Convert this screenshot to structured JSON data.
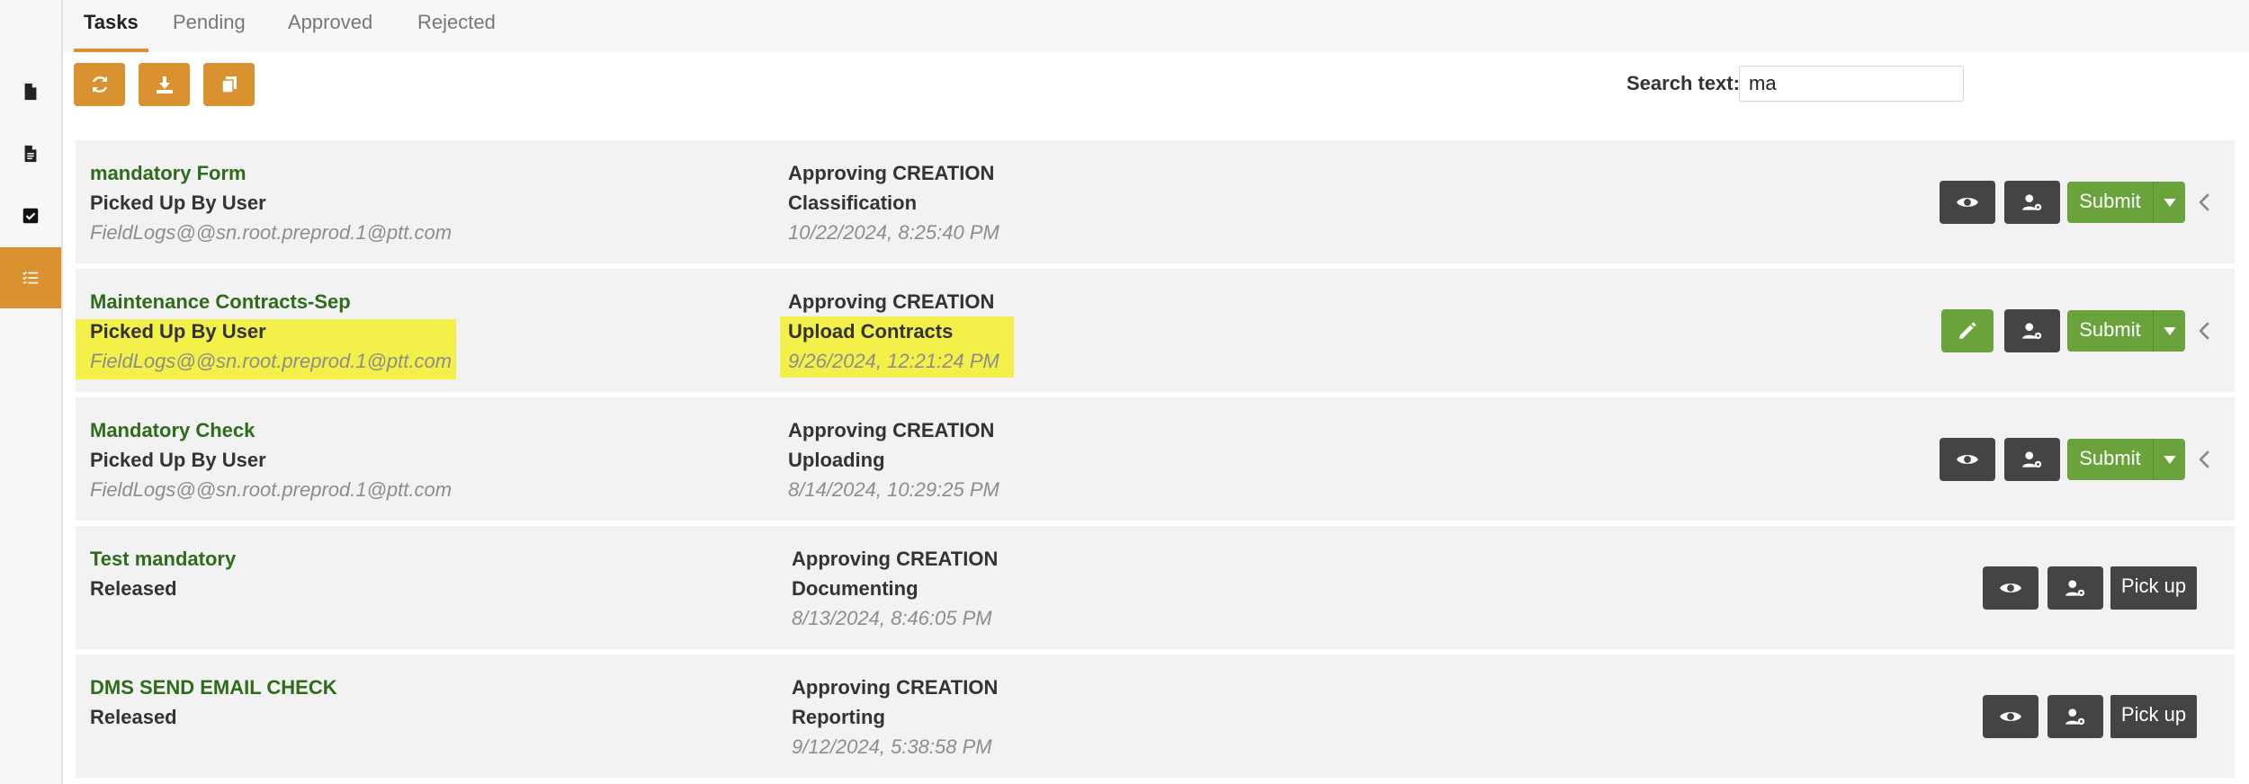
{
  "tabs": [
    "Tasks",
    "Pending",
    "Approved",
    "Rejected"
  ],
  "rail": {
    "items": [
      "document-icon",
      "document-lines-icon",
      "checkbox-icon",
      "task-list-icon"
    ]
  },
  "toolbar": {
    "refresh_icon": "refresh-icon",
    "download_icon": "download-icon",
    "copy_icon": "copy-icon"
  },
  "search": {
    "label": "Search text:",
    "value": "ma"
  },
  "tasks": [
    {
      "title": "mandatory Form",
      "status": "Picked Up By User",
      "user": "FieldLogs@@sn.root.preprod.1@ptt.com",
      "stage": "Approving CREATION",
      "step": "Classification",
      "date": "10/22/2024, 8:25:40 PM",
      "action": "Submit"
    },
    {
      "title": "Maintenance Contracts-Sep",
      "status": "Picked Up By User",
      "user": "FieldLogs@@sn.root.preprod.1@ptt.com",
      "stage": "Approving CREATION",
      "step": "Upload Contracts",
      "date": "9/26/2024, 12:21:24 PM",
      "action": "Submit"
    },
    {
      "title": "Mandatory Check",
      "status": "Picked Up By User",
      "user": "FieldLogs@@sn.root.preprod.1@ptt.com",
      "stage": "Approving CREATION",
      "step": "Uploading",
      "date": "8/14/2024, 10:29:25 PM",
      "action": "Submit"
    },
    {
      "title": "Test mandatory",
      "status": "Released",
      "user": "",
      "stage": "Approving CREATION",
      "step": "Documenting",
      "date": "8/13/2024, 8:46:05 PM",
      "action": "Pick up"
    },
    {
      "title": "DMS SEND EMAIL CHECK",
      "status": "Released",
      "user": "",
      "stage": "Approving CREATION",
      "step": "Reporting",
      "date": "9/12/2024, 5:38:58 PM",
      "action": "Pick up"
    }
  ],
  "colors": {
    "accent": "#d9922f",
    "title_green": "#2e6b1a",
    "button_green": "#6aa33b",
    "button_dark": "#444444",
    "highlight": "#f4f04a"
  }
}
